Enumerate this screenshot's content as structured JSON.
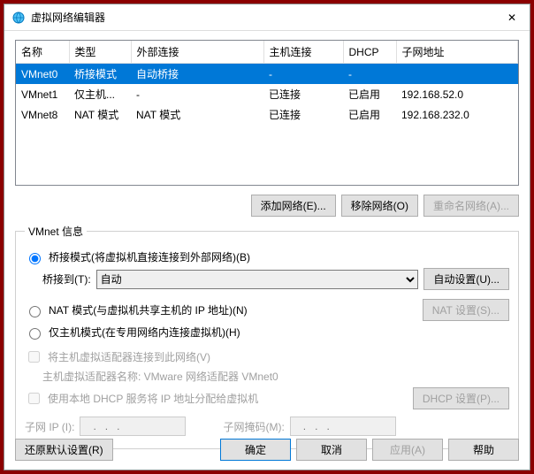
{
  "window": {
    "title": "虚拟网络编辑器",
    "close": "✕"
  },
  "table": {
    "headers": {
      "name": "名称",
      "type": "类型",
      "ext": "外部连接",
      "host": "主机连接",
      "dhcp": "DHCP",
      "subnet": "子网地址"
    },
    "rows": [
      {
        "name": "VMnet0",
        "type": "桥接模式",
        "ext": "自动桥接",
        "host": "-",
        "dhcp": "-",
        "subnet": ""
      },
      {
        "name": "VMnet1",
        "type": "仅主机...",
        "ext": "-",
        "host": "已连接",
        "dhcp": "已启用",
        "subnet": "192.168.52.0"
      },
      {
        "name": "VMnet8",
        "type": "NAT 模式",
        "ext": "NAT 模式",
        "host": "已连接",
        "dhcp": "已启用",
        "subnet": "192.168.232.0"
      }
    ]
  },
  "buttons": {
    "add_net": "添加网络(E)...",
    "remove_net": "移除网络(O)",
    "rename_net": "重命名网络(A)...",
    "auto_set": "自动设置(U)...",
    "nat_set": "NAT 设置(S)...",
    "dhcp_set": "DHCP 设置(P)...",
    "restore": "还原默认设置(R)",
    "ok": "确定",
    "cancel": "取消",
    "apply": "应用(A)",
    "help": "帮助"
  },
  "info": {
    "legend": "VMnet 信息",
    "bridge_radio": "桥接模式(将虚拟机直接连接到外部网络)(B)",
    "bridge_to": "桥接到(T):",
    "bridge_sel": "自动",
    "nat_radio": "NAT 模式(与虚拟机共享主机的 IP 地址)(N)",
    "hostonly_radio": "仅主机模式(在专用网络内连接虚拟机)(H)",
    "connect_host": "将主机虚拟适配器连接到此网络(V)",
    "adapter_name": "主机虚拟适配器名称: VMware 网络适配器 VMnet0",
    "use_dhcp": "使用本地 DHCP 服务将 IP 地址分配给虚拟机",
    "subnet_ip": "子网 IP (I):",
    "subnet_mask": "子网掩码(M):",
    "ip_placeholder": "   .   .   .   "
  }
}
